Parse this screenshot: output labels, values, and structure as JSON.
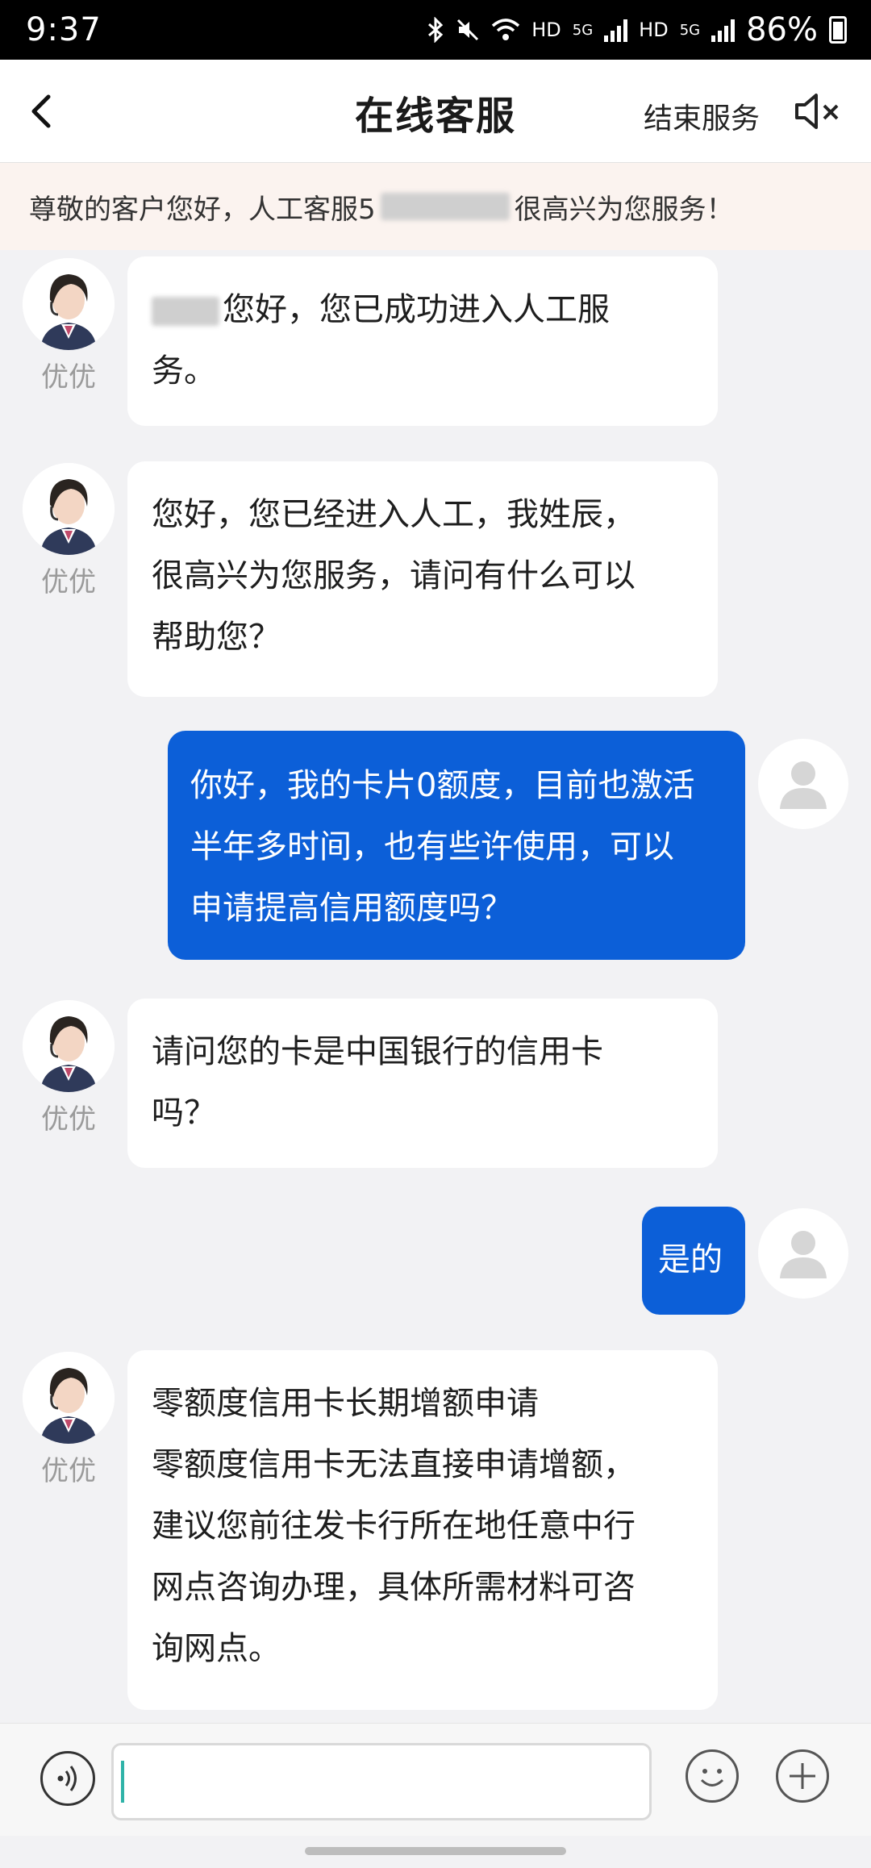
{
  "status": {
    "time": "9:37",
    "hd1": "HD",
    "net1": "5G",
    "hd2": "HD",
    "net2": "5G",
    "battery": "86%"
  },
  "nav": {
    "title": "在线客服",
    "end_label": "结束服务"
  },
  "notice": {
    "prefix": "尊敬的客户您好，人工客服5",
    "suffix": "很高兴为您服务！"
  },
  "agent": {
    "name": "优优"
  },
  "messages": [
    {
      "from": "agent",
      "text_line1": "您好，您已成功进入人工服",
      "text_line2": "务。"
    },
    {
      "from": "agent",
      "lines": [
        "您好，您已经进入人工，我姓辰，",
        "很高兴为您服务，请问有什么可以",
        "帮助您？"
      ]
    },
    {
      "from": "user",
      "lines": [
        "你好，我的卡片0额度，目前也激活",
        "半年多时间，也有些许使用，可以",
        "申请提高信用额度吗？"
      ]
    },
    {
      "from": "agent",
      "lines": [
        "请问您的卡是中国银行的信用卡",
        "吗？"
      ]
    },
    {
      "from": "user",
      "lines": [
        "是的"
      ]
    },
    {
      "from": "agent",
      "lines": [
        "零额度信用卡长期增额申请",
        "零额度信用卡无法直接申请增额，",
        "建议您前往发卡行所在地任意中行",
        "网点咨询办理，具体所需材料可咨",
        "询网点。"
      ]
    }
  ],
  "input": {
    "value": "",
    "placeholder": ""
  },
  "icons": {
    "back": "chevron-left-icon",
    "mute": "speaker-mute-icon",
    "voice": "voice-icon",
    "emoji": "smiley-icon",
    "plus": "plus-icon"
  },
  "colors": {
    "user_bubble": "#0c5fd8",
    "notice_bg": "#fbf3ef",
    "caret": "#2fb3a8"
  }
}
